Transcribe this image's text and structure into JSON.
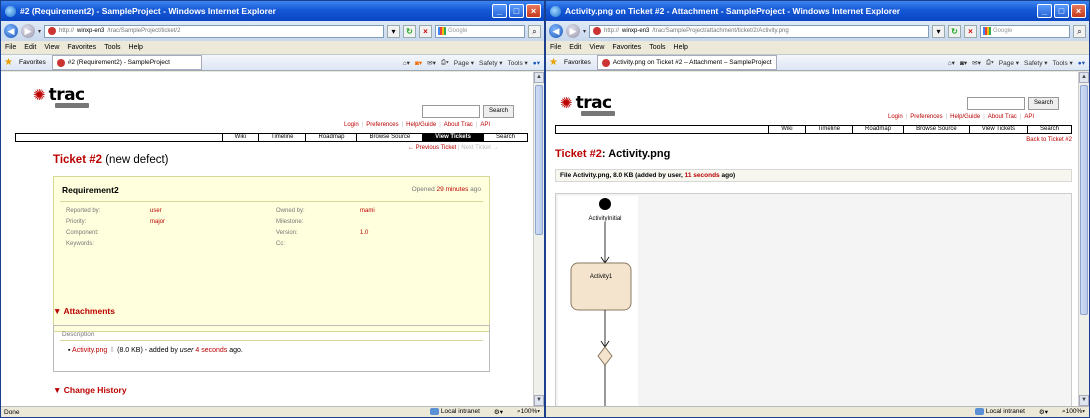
{
  "win1": {
    "title": "#2 (Requirement2) - SampleProject - Windows Internet Explorer",
    "url_host": "winxp-en3",
    "url_path": "/trac/SampleProject/ticket/2",
    "search_placeholder": "Google",
    "menus": [
      "File",
      "Edit",
      "View",
      "Favorites",
      "Tools",
      "Help"
    ],
    "favorites_label": "Favorites",
    "tab_title": "#2 (Requirement2) - SampleProject",
    "toolbar_right": [
      "Page ▾",
      "Safety ▾",
      "Tools ▾"
    ],
    "trac": {
      "logo": "trac",
      "search_button": "Search",
      "metanav": [
        "Login",
        "Preferences",
        "Help/Guide",
        "About Trac",
        "API"
      ],
      "mainnav": [
        "Wiki",
        "Timeline",
        "Roadmap",
        "Browse Source",
        "View Tickets",
        "Search"
      ],
      "ctxnav_prev": "← Previous Ticket",
      "ctxnav_next": "Next Ticket →",
      "heading_ticket": "Ticket #2",
      "heading_status": "(new defect)",
      "summary": "Requirement2",
      "opened_prefix": "Opened",
      "opened_link": "29 minutes",
      "opened_suffix": "ago",
      "props": [
        {
          "k": "Reported by:",
          "v": "user"
        },
        {
          "k": "Owned by:",
          "v": "mami"
        },
        {
          "k": "Priority:",
          "v": "major"
        },
        {
          "k": "Milestone:",
          "v": ""
        },
        {
          "k": "Component:",
          "v": ""
        },
        {
          "k": "Version:",
          "v": "1.0"
        },
        {
          "k": "Keywords:",
          "v": ""
        },
        {
          "k": "Cc:",
          "v": ""
        }
      ],
      "description_label": "Description",
      "attachments_heading": "▼ Attachments",
      "attachment": {
        "name": "Activity.png",
        "size": "(8.0 KB)",
        "added": "- added by",
        "user": "user",
        "age": "4 seconds",
        "ago": "ago."
      },
      "change_history_heading": "▼ Change History"
    },
    "status": {
      "text": "Done",
      "zone": "Local intranet",
      "zoom": "100%"
    }
  },
  "win2": {
    "title": "Activity.png on Ticket #2 - Attachment - SampleProject - Windows Internet Explorer",
    "url_host": "winxp-en3",
    "url_path": "/trac/SampleProject/attachment/ticket/2/Activity.png",
    "search_placeholder": "Google",
    "menus": [
      "File",
      "Edit",
      "View",
      "Favorites",
      "Tools",
      "Help"
    ],
    "favorites_label": "Favorites",
    "tab_title": "Activity.png on Ticket #2 – Attachment – SampleProject",
    "toolbar_right": [
      "Page ▾",
      "Safety ▾",
      "Tools ▾"
    ],
    "trac": {
      "logo": "trac",
      "search_button": "Search",
      "metanav": [
        "Login",
        "Preferences",
        "Help/Guide",
        "About Trac",
        "API"
      ],
      "mainnav": [
        "Wiki",
        "Timeline",
        "Roadmap",
        "Browse Source",
        "View Tickets",
        "Search"
      ],
      "back_link": "Back to Ticket #2",
      "heading_ticket": "Ticket #2",
      "heading_file": ": Activity.png",
      "file_prefix": "File Activity.png, 8.0 KB (added by user,",
      "file_age": "11 seconds",
      "file_suffix": "ago)",
      "diagram": {
        "initial_label": "ActivityInitial",
        "activity_label": "Activity1"
      }
    },
    "status": {
      "text": "",
      "zone": "Local intranet",
      "zoom": "100%"
    }
  }
}
